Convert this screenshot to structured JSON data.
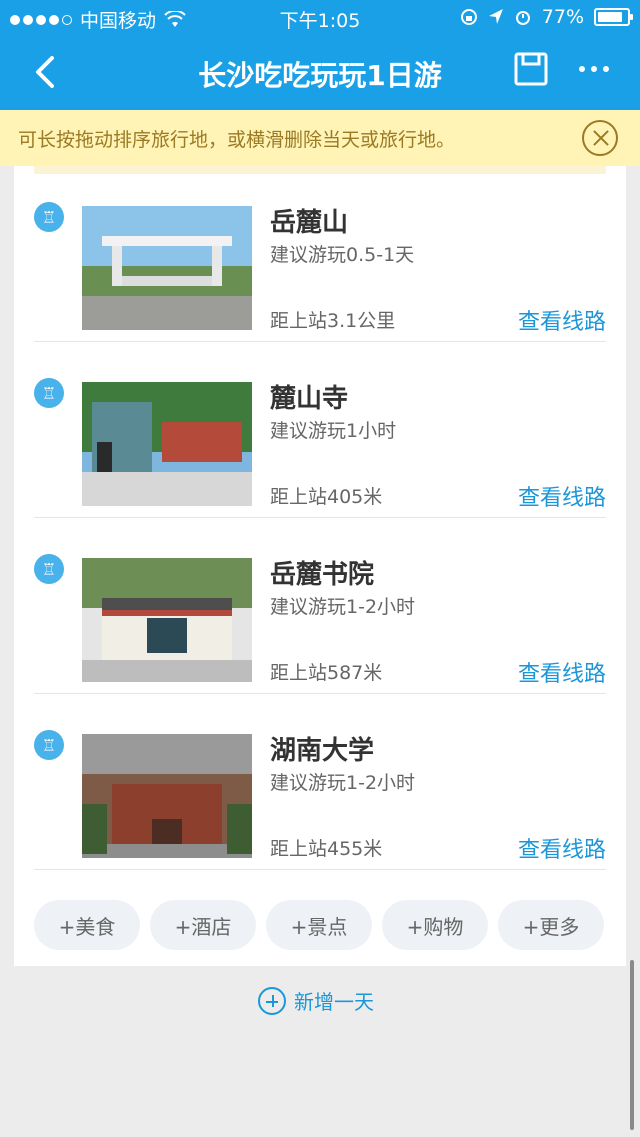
{
  "status_bar": {
    "carrier": "中国移动",
    "time": "下午1:05",
    "battery": "77%"
  },
  "nav": {
    "title": "长沙吃吃玩玩1日游"
  },
  "tip": {
    "text": "可长按拖动排序旅行地，或横滑删除当天或旅行地。"
  },
  "items": [
    {
      "name": "岳麓山",
      "suggest": "建议游玩0.5-1天",
      "distance": "距上站3.1公里",
      "route_label": "查看线路"
    },
    {
      "name": "麓山寺",
      "suggest": "建议游玩1小时",
      "distance": "距上站405米",
      "route_label": "查看线路"
    },
    {
      "name": "岳麓书院",
      "suggest": "建议游玩1-2小时",
      "distance": "距上站587米",
      "route_label": "查看线路"
    },
    {
      "name": "湖南大学",
      "suggest": "建议游玩1-2小时",
      "distance": "距上站455米",
      "route_label": "查看线路"
    }
  ],
  "add_buttons": [
    "+美食",
    "+酒店",
    "+景点",
    "+购物",
    "+更多"
  ],
  "add_day": "新增一天",
  "colors": {
    "primary": "#1aa0e6",
    "link": "#1b97d9",
    "tip_bg": "#fff3b6",
    "tip_text": "#9b7a24"
  }
}
